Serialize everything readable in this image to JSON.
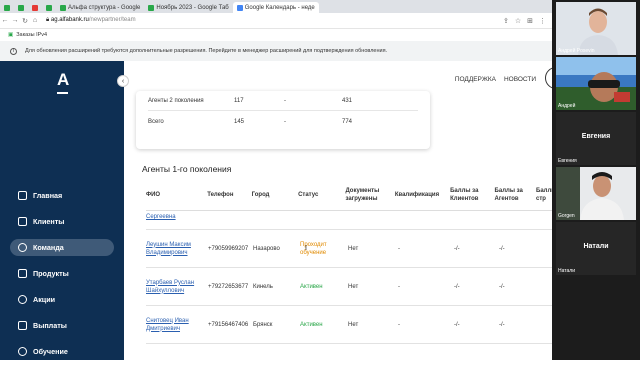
{
  "browser": {
    "tabs": [
      {
        "label": "",
        "color": "#29a84a"
      },
      {
        "label": "",
        "color": "#29a84a"
      },
      {
        "label": "",
        "color": "#e53935"
      },
      {
        "label": "",
        "color": "#29a84a"
      },
      {
        "label": "Альфа структура - Google",
        "color": "#29a84a"
      },
      {
        "label": "Ноябрь 2023 - Google Таб",
        "color": "#29a84a"
      },
      {
        "label": "Google Календарь - неде",
        "color": "#4285f4"
      }
    ],
    "url_host": "ag.alfabank.ru",
    "url_path": "/newpartner/team",
    "bookmark": "Заказы IPv4",
    "info_message": "Для обновления расширений требуются дополнительные разрешения. Перейдите в менеджер расширений для подтверждения обновления."
  },
  "sidebar": {
    "logo": "A",
    "items": [
      {
        "label": "Главная",
        "active": false
      },
      {
        "label": "Клиенты",
        "active": false
      },
      {
        "label": "Команда",
        "active": true
      },
      {
        "label": "Продукты",
        "active": false
      },
      {
        "label": "Акции",
        "active": false
      },
      {
        "label": "Выплаты",
        "active": false
      },
      {
        "label": "Обучение",
        "active": false
      }
    ]
  },
  "topnav": {
    "support": "ПОДДЕРЖКА",
    "news": "НОВОСТИ"
  },
  "summary": {
    "row1": {
      "label": "Агенты 2 поколения",
      "v1": "117",
      "v2": "-",
      "v3": "431"
    },
    "row2": {
      "label": "Всего",
      "v1": "145",
      "v2": "-",
      "v3": "774"
    }
  },
  "section_title": "Агенты 1-го поколения",
  "table": {
    "headers": {
      "fio": "ФИО",
      "phone": "Телефон",
      "city": "Город",
      "status": "Статус",
      "docs": "Документы загружены",
      "qual": "Квалификация",
      "bc": "Баллы за Клиентов",
      "ba": "Баллы за Агентов",
      "bs": "Баллы стр"
    },
    "partial_name": "Сергеевна",
    "rows": [
      {
        "name": "Леушин Максим Владимирович",
        "phone": "+79059969207",
        "city": "Назарово",
        "status": "Проходит обучение",
        "docs": "Нет",
        "qual": "-",
        "bc": "-/-",
        "ba": "-/-"
      },
      {
        "name": "Утарбаев Руслан Шайхуллович",
        "phone": "+79272653677",
        "city": "Кинель",
        "status": "Активен",
        "docs": "Нет",
        "qual": "-",
        "bc": "-/-",
        "ba": "-/-"
      },
      {
        "name": "Снитовец Иван Дмитриевич",
        "phone": "+79156467406",
        "city": "Брянск",
        "status": "Активен",
        "docs": "Нет",
        "qual": "-",
        "bc": "-/-",
        "ba": "-/-"
      }
    ]
  },
  "participants": {
    "p1": "Андрей Posevin",
    "p2": "Андрей",
    "p3": "Евгения",
    "p3_caption": "Евгения",
    "p4": "Gorgen",
    "p5": "Натали",
    "p5_caption": "Натали"
  }
}
